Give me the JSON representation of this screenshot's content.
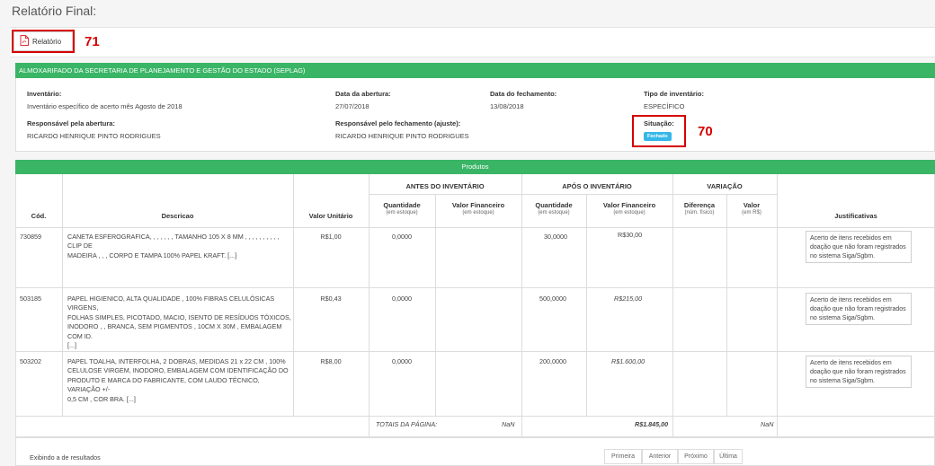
{
  "page": {
    "title": "Relatório Final:"
  },
  "report": {
    "label": "Relatório",
    "annotation": "71"
  },
  "info": {
    "header": "ALMOXARIFADO DA SECRETARIA DE PLANEJAMENTO E GESTÃO DO ESTADO (SEPLAG)",
    "inventario_label": "Inventário:",
    "inventario_value": "Inventário específico de acerto mês Agosto de 2018",
    "abertura_label": "Data da abertura:",
    "abertura_value": "27/07/2018",
    "fechamento_label": "Data do fechamento:",
    "fechamento_value": "13/08/2018",
    "tipo_label": "Tipo de inventário:",
    "tipo_value": "ESPECÍFICO",
    "resp_abertura_label": "Responsável pela abertura:",
    "resp_abertura_value": "RICARDO HENRIQUE PINTO RODRIGUES",
    "resp_fechamento_label": "Responsável pelo fechamento (ajuste):",
    "resp_fechamento_value": "RICARDO HENRIQUE PINTO RODRIGUES",
    "situacao_label": "Situação:",
    "situacao_value": "Fechado",
    "situacao_annotation": "70",
    "badge_color": "#36b7e8"
  },
  "products": {
    "header": "Produtos",
    "groups": {
      "antes": "ANTES DO INVENTÁRIO",
      "apos": "APÓS O INVENTÁRIO",
      "variacao": "VARIAÇÃO"
    },
    "columns": {
      "cod": "Cód.",
      "descricao": "Descricao",
      "valor_unitario": "Valor Unitário",
      "quantidade": "Quantidade",
      "quantidade_sub": "(em estoque)",
      "valor_financeiro": "Valor Financeiro",
      "valor_financeiro_sub": "(em estoque)",
      "diferenca": "Diferença",
      "diferenca_sub": "(núm. físico)",
      "valor": "Valor",
      "valor_sub": "(em R$)",
      "justificativas": "Justificativas"
    },
    "rows": [
      {
        "cod": "730859",
        "desc": [
          "CANETA ESFEROGRAFICA, , , , , , , TAMANHO 105 X 8 MM , , , , , , , , , , CLIP DE",
          "MADEIRA , , , CORPO E TAMPA 100% PAPEL KRAFT. [...]"
        ],
        "unit": "R$1,00",
        "qtd_antes": "0,0000",
        "val_antes": "",
        "qtd_apos": "30,0000",
        "val_apos": "R$30,00",
        "justificativa": "Acerto de itens recebidos em doação que não foram registrados no sistema Siga/Sgbm."
      },
      {
        "cod": "503185",
        "desc": [
          "PAPEL HIGIENICO, ALTA QUALIDADE , 100% FIBRAS CELULÓSICAS VIRGENS,",
          "FOLHAS SIMPLES, PICOTADO, MACIO, ISENTO DE RESÍDUOS TÓXICOS,",
          "INODORO , , BRANCA, SEM PIGMENTOS , 10CM X 30M , EMBALAGEM COM ID.",
          "[...]"
        ],
        "unit": "R$0,43",
        "qtd_antes": "0,0000",
        "val_antes": "",
        "qtd_apos": "500,0000",
        "val_apos": "R$215,00",
        "justificativa": "Acerto de itens recebidos em doação que não foram registrados no sistema Siga/Sgbm."
      },
      {
        "cod": "503202",
        "desc": [
          "PAPEL TOALHA, INTERFOLHA, 2 DOBRAS, MEDIDAS 21 x 22 CM , 100%",
          "CELULOSE VIRGEM, INODORO, EMBALAGEM COM IDENTIFICAÇÃO DO",
          "PRODUTO E MARCA DO FABRICANTE, COM LAUDO TÉCNICO, VARIAÇÃO +/-",
          "0,5 CM , COR BRA. [...]"
        ],
        "unit": "R$8,00",
        "qtd_antes": "0,0000",
        "val_antes": "",
        "qtd_apos": "200,0000",
        "val_apos": "R$1.600,00",
        "justificativa": "Acerto de itens recebidos em doação que não foram registrados no sistema Siga/Sgbm."
      }
    ],
    "totals": {
      "label": "TOTAIS DA PÁGINA:",
      "antes": "NaN",
      "apos": "R$1.845,00",
      "variacao": "NaN"
    }
  },
  "footer": {
    "info": "Exibindo a de resultados",
    "pager": [
      "Primeira",
      "Anterior",
      "Próximo",
      "Última"
    ]
  }
}
